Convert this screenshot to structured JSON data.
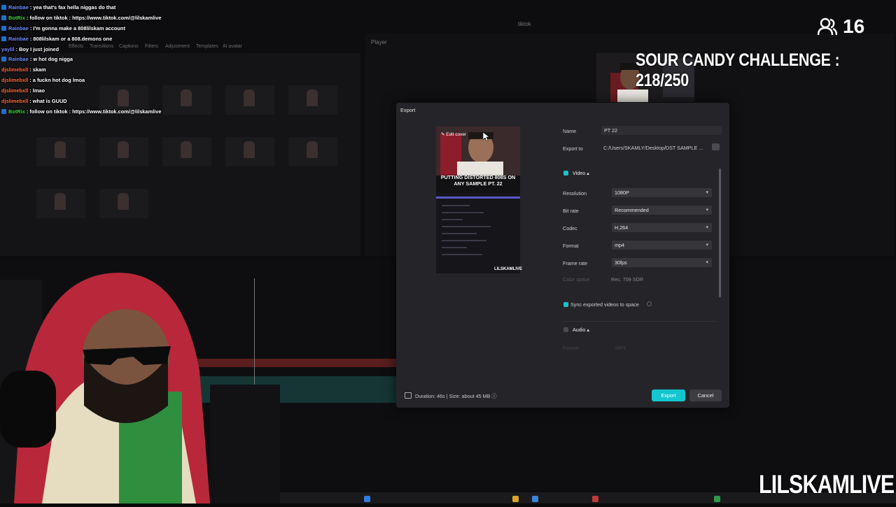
{
  "chat": [
    {
      "user": "Rainbae",
      "color": "#6f8cff",
      "text": "yea that's fax hella niggas do that"
    },
    {
      "user": "BotRix",
      "color": "#3fd23f",
      "text": "follow on tiktok : https://www.tiktok.com/@lilskamlive"
    },
    {
      "user": "Rainbae",
      "color": "#6f8cff",
      "text": "I'm gonna make a 808lilskam account"
    },
    {
      "user": "Rainbae",
      "color": "#6f8cff",
      "text": "808lilskam or a 808.demons one"
    },
    {
      "user": "yaylil",
      "color": "#6f8cff",
      "text": "Boy I just joined"
    },
    {
      "user": "Rainbae",
      "color": "#6f8cff",
      "text": "w hot dog nigga"
    },
    {
      "user": "djslimebxll",
      "color": "#ff6b3a",
      "text": "skam"
    },
    {
      "user": "djslimebxll",
      "color": "#ff6b3a",
      "text": "a fuckn hot dog lmoa"
    },
    {
      "user": "djslimebxll",
      "color": "#ff6b3a",
      "text": "lmao"
    },
    {
      "user": "djslimebxll",
      "color": "#ff6b3a",
      "text": "what is GUUD"
    },
    {
      "user": "BotRix",
      "color": "#3fd23f",
      "text": "follow on tiktok : https://www.tiktok.com/@lilskamlive"
    }
  ],
  "overlay": {
    "viewer_count": "16",
    "challenge": "SOUR CANDY CHALLENGE : 218/250",
    "brand": "LILSKAMLIVE"
  },
  "editor": {
    "app_title": "tiktok",
    "player_label": "Player",
    "tabs": [
      "Effects",
      "Transitions",
      "Captions",
      "Filters",
      "Adjustment",
      "Templates",
      "AI avatar"
    ]
  },
  "dialog": {
    "title": "Export",
    "edit_cover": "Edit cover",
    "cover_caption": "PUTTING DISTORTED 808S ON ANY SAMPLE PT. 22",
    "cover_watermark": "LILSKAMLIVE",
    "name_label": "Name",
    "name_value": "PT 22",
    "export_to_label": "Export to",
    "export_path": "C:/Users/SKAMLY/Desktop/DST SAMPLE ...",
    "video_section": "Video",
    "video_checked": true,
    "settings": [
      {
        "label": "Resolution",
        "value": "1080P"
      },
      {
        "label": "Bit rate",
        "value": "Recommended"
      },
      {
        "label": "Codec",
        "value": "H.264"
      },
      {
        "label": "Format",
        "value": "mp4"
      },
      {
        "label": "Frame rate",
        "value": "30fps"
      }
    ],
    "color_space_label": "Color space",
    "color_space_value": "Rec. 709 SDR",
    "sync_label": "Sync exported videos to space",
    "sync_checked": true,
    "audio_section": "Audio",
    "audio_checked": false,
    "audio_format_label": "Format",
    "audio_format_value": "MP3",
    "footer_info": "Duration: 46s | Size: about 45 MB",
    "export_button": "Export",
    "cancel_button": "Cancel"
  },
  "colors": {
    "accent": "#14c7cf",
    "dialog_bg": "#252529"
  }
}
